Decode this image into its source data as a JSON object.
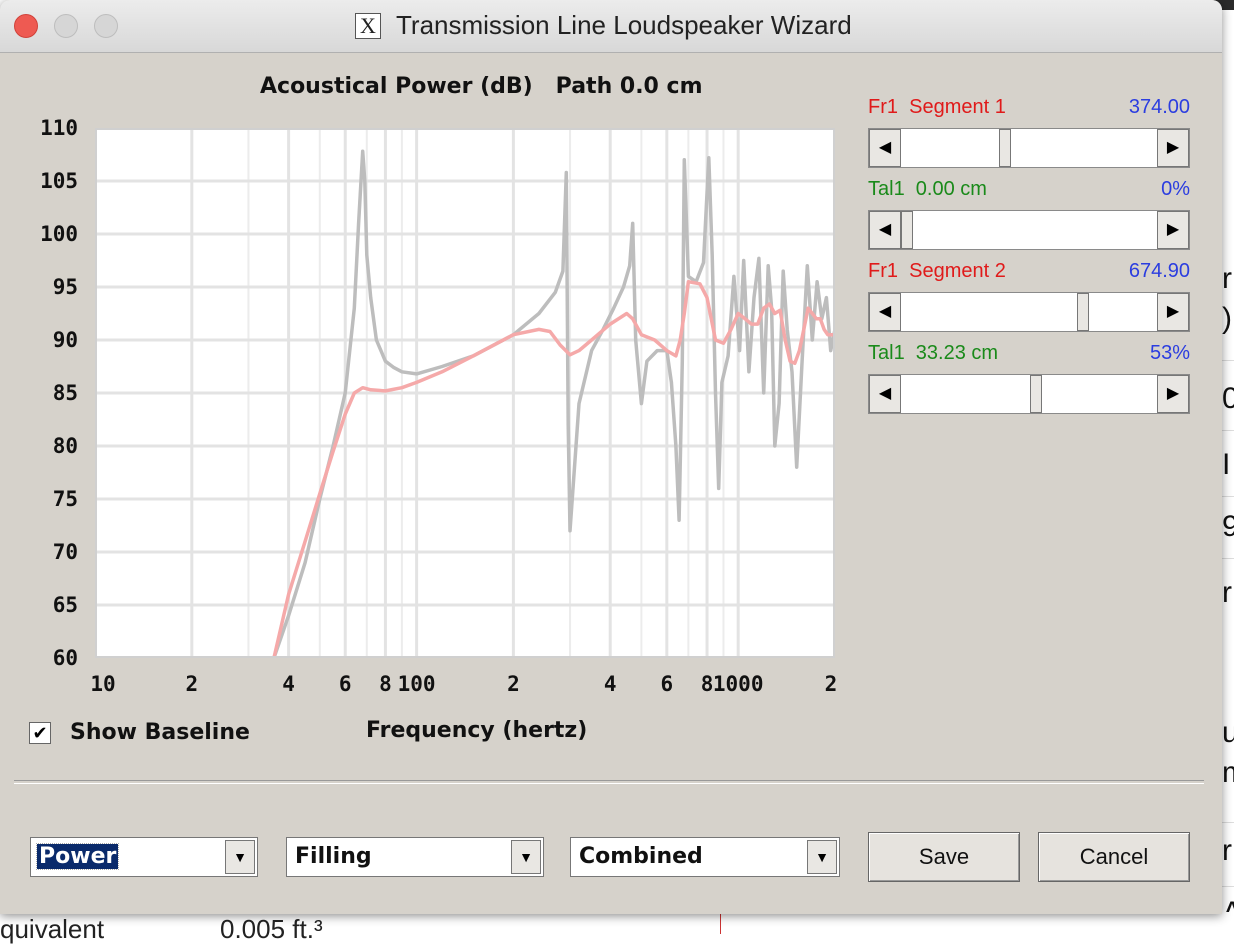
{
  "window": {
    "title": "Transmission Line Loudspeaker Wizard",
    "app_icon_glyph": "X"
  },
  "chart_data": {
    "type": "line",
    "title": "Acoustical Power (dB)   Path 0.0 cm",
    "xlabel": "Frequency (hertz)",
    "ylabel": "",
    "xscale": "log",
    "xlim": [
      10,
      2000
    ],
    "ylim": [
      60,
      110
    ],
    "grid": true,
    "y_ticks": [
      "110",
      "105",
      "100",
      "95",
      "90",
      "85",
      "80",
      "75",
      "70",
      "65",
      "60"
    ],
    "x_ticks": [
      "10",
      "2",
      "4",
      "6",
      "8",
      "100",
      "2",
      "4",
      "6",
      "8",
      "1000",
      "2"
    ],
    "x_tick_values": [
      10,
      20,
      40,
      60,
      80,
      100,
      200,
      400,
      600,
      800,
      1000,
      2000
    ],
    "series": [
      {
        "color": "#bdbdbd",
        "x": [
          36,
          40,
          45,
          50,
          55,
          60,
          64,
          66,
          68,
          69,
          70,
          72,
          75,
          80,
          85,
          90,
          100,
          120,
          150,
          200,
          240,
          270,
          285,
          292,
          296,
          300,
          320,
          350,
          380,
          410,
          440,
          460,
          470,
          480,
          500,
          520,
          560,
          600,
          620,
          640,
          655,
          670,
          680,
          700,
          740,
          780,
          810,
          830,
          850,
          870,
          890,
          930,
          970,
          1010,
          1040,
          1080,
          1120,
          1160,
          1200,
          1240,
          1270,
          1300,
          1340,
          1380,
          1420,
          1470,
          1520,
          1580,
          1640,
          1700,
          1760,
          1820,
          1880,
          1940,
          2000
        ],
        "y": [
          60,
          64,
          69,
          75,
          80,
          85,
          93,
          101,
          107.8,
          105,
          98,
          94,
          90,
          88,
          87.4,
          87,
          86.8,
          87.5,
          88.5,
          90.5,
          92.5,
          94.5,
          96.5,
          105.8,
          82,
          72,
          84,
          89,
          91,
          93,
          95,
          97,
          101,
          90,
          84,
          88,
          89,
          89,
          86,
          80,
          73,
          88,
          107,
          96,
          95.5,
          97.3,
          107.2,
          98,
          85,
          76,
          86,
          88.5,
          96,
          89,
          97.5,
          87,
          94,
          97.7,
          85,
          97,
          93,
          80,
          84,
          96.5,
          91,
          87,
          78,
          88,
          97,
          90,
          95.5,
          92,
          94,
          89,
          91
        ],
        "name": ""
      },
      {
        "color": "#f5a9a9",
        "x": [
          36,
          40,
          45,
          50,
          55,
          60,
          64,
          68,
          72,
          80,
          90,
          100,
          120,
          150,
          200,
          240,
          260,
          280,
          300,
          320,
          350,
          400,
          450,
          470,
          500,
          550,
          600,
          640,
          660,
          680,
          700,
          760,
          800,
          850,
          900,
          950,
          1000,
          1050,
          1100,
          1150,
          1200,
          1250,
          1300,
          1350,
          1400,
          1450,
          1500,
          1550,
          1600,
          1650,
          1700,
          1750,
          1800,
          1850,
          1900,
          1950,
          2000
        ],
        "y": [
          60,
          66,
          71,
          75.5,
          79.5,
          83,
          85,
          85.5,
          85.3,
          85.2,
          85.5,
          86,
          87,
          88.5,
          90.5,
          91,
          90.8,
          89.5,
          88.6,
          89,
          90,
          91.5,
          92.5,
          92,
          90.5,
          90,
          89,
          88.5,
          90,
          92.5,
          95.5,
          95.3,
          94,
          90,
          89.7,
          91,
          92.5,
          92,
          91.5,
          91.5,
          93,
          93.4,
          92.5,
          92.8,
          90,
          88,
          87.8,
          89,
          91,
          93,
          92.5,
          92,
          92,
          91,
          90.5,
          90.5,
          90.5
        ],
        "name": ""
      }
    ]
  },
  "sliders": [
    {
      "label": "Fr1  Segment 1",
      "value": "374.00",
      "label_color": "red",
      "thumb_fraction": 0.4
    },
    {
      "label": "Tal1  0.00 cm",
      "value": "0%",
      "label_color": "green",
      "thumb_fraction": 0.0
    },
    {
      "label": "Fr1  Segment 2",
      "value": "674.90",
      "label_color": "red",
      "thumb_fraction": 0.72
    },
    {
      "label": "Tal1  33.23 cm",
      "value": "53%",
      "label_color": "green",
      "thumb_fraction": 0.53
    }
  ],
  "controls": {
    "show_baseline_label": "Show Baseline",
    "show_baseline_checked": true,
    "combo1": "Power",
    "combo2": "Filling",
    "combo3": "Combined",
    "save_label": "Save",
    "cancel_label": "Cancel"
  },
  "background": {
    "bottom_left_text": "quivalent",
    "bottom_value_text": "0.005 ft.³",
    "right_fragments": [
      "r",
      ")",
      "0",
      "I",
      "9",
      "r",
      "u",
      "m",
      "r",
      "A"
    ]
  }
}
